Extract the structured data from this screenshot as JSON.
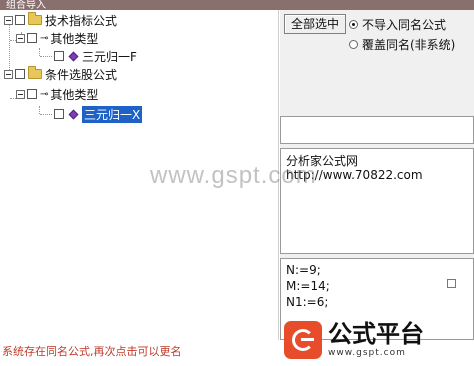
{
  "window": {
    "title": "组合导入"
  },
  "tree": {
    "nodes": [
      {
        "label": "技术指标公式"
      },
      {
        "label": "其他类型"
      },
      {
        "label": "三元归一F"
      },
      {
        "label": "条件选股公式"
      },
      {
        "label": "其他类型"
      },
      {
        "label": "三元归一X",
        "selected": true
      }
    ]
  },
  "options": {
    "select_all_label": "全部选中",
    "radio_no_import": "不导入同名公式",
    "radio_overwrite": "覆盖同名(非系统)",
    "selected_radio": "no_import"
  },
  "info": {
    "name": "分析家公式网",
    "url": "http://www.70822.com"
  },
  "code": {
    "lines": [
      "N:=9;",
      "M:=14;",
      "N1:=6;"
    ]
  },
  "status": {
    "text": "系统存在同名公式,再次点击可以更名"
  },
  "watermark": {
    "url_text": "www.gspt.com",
    "logo_title": "公式平台",
    "logo_url": "www.gspt.com"
  },
  "colors": {
    "selection": "#1e62c8",
    "status_text": "#c0392b",
    "logo_red": "#e74c2b"
  }
}
